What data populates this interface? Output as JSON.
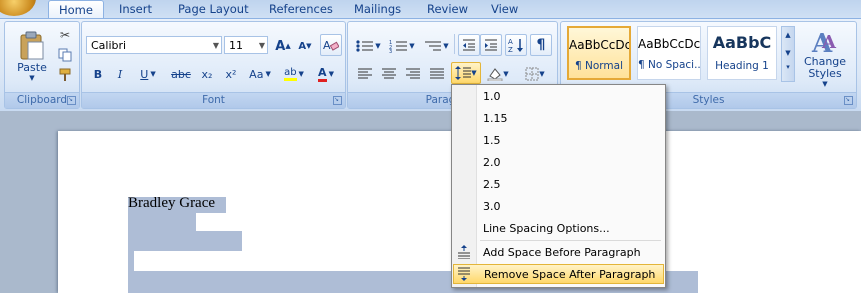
{
  "tabs": [
    "Home",
    "Insert",
    "Page Layout",
    "References",
    "Mailings",
    "Review",
    "View"
  ],
  "clipboard": {
    "paste_label": "Paste",
    "group_label": "Clipboard"
  },
  "font": {
    "name": "Calibri",
    "size": "11",
    "group_label": "Font",
    "buttons": {
      "grow": "A",
      "shrink": "A",
      "bold": "B",
      "italic": "I",
      "underline": "U",
      "strike": "abc",
      "sub": "x₂",
      "sup": "x²",
      "case": "Aa",
      "highlight": "ab",
      "color": "A"
    }
  },
  "paragraph": {
    "group_label": "Paragraph"
  },
  "styles": {
    "group_label": "Styles",
    "items": [
      {
        "preview": "AaBbCcDc",
        "name": "¶ Normal"
      },
      {
        "preview": "AaBbCcDc",
        "name": "¶ No Spaci..."
      },
      {
        "preview": "AaBbC",
        "name": "Heading 1"
      }
    ],
    "change_styles": "Change Styles"
  },
  "document": {
    "line1": "Bradley Grace"
  },
  "line_spacing_menu": {
    "values": [
      "1.0",
      "1.15",
      "1.5",
      "2.0",
      "2.5",
      "3.0"
    ],
    "options": "Line Spacing Options...",
    "add_before": "Add Space Before Paragraph",
    "remove_after": "Remove Space After Paragraph"
  },
  "colors": {
    "accent": "#15428b",
    "hover": "#ffd86b",
    "selection": "#aebdd6"
  }
}
